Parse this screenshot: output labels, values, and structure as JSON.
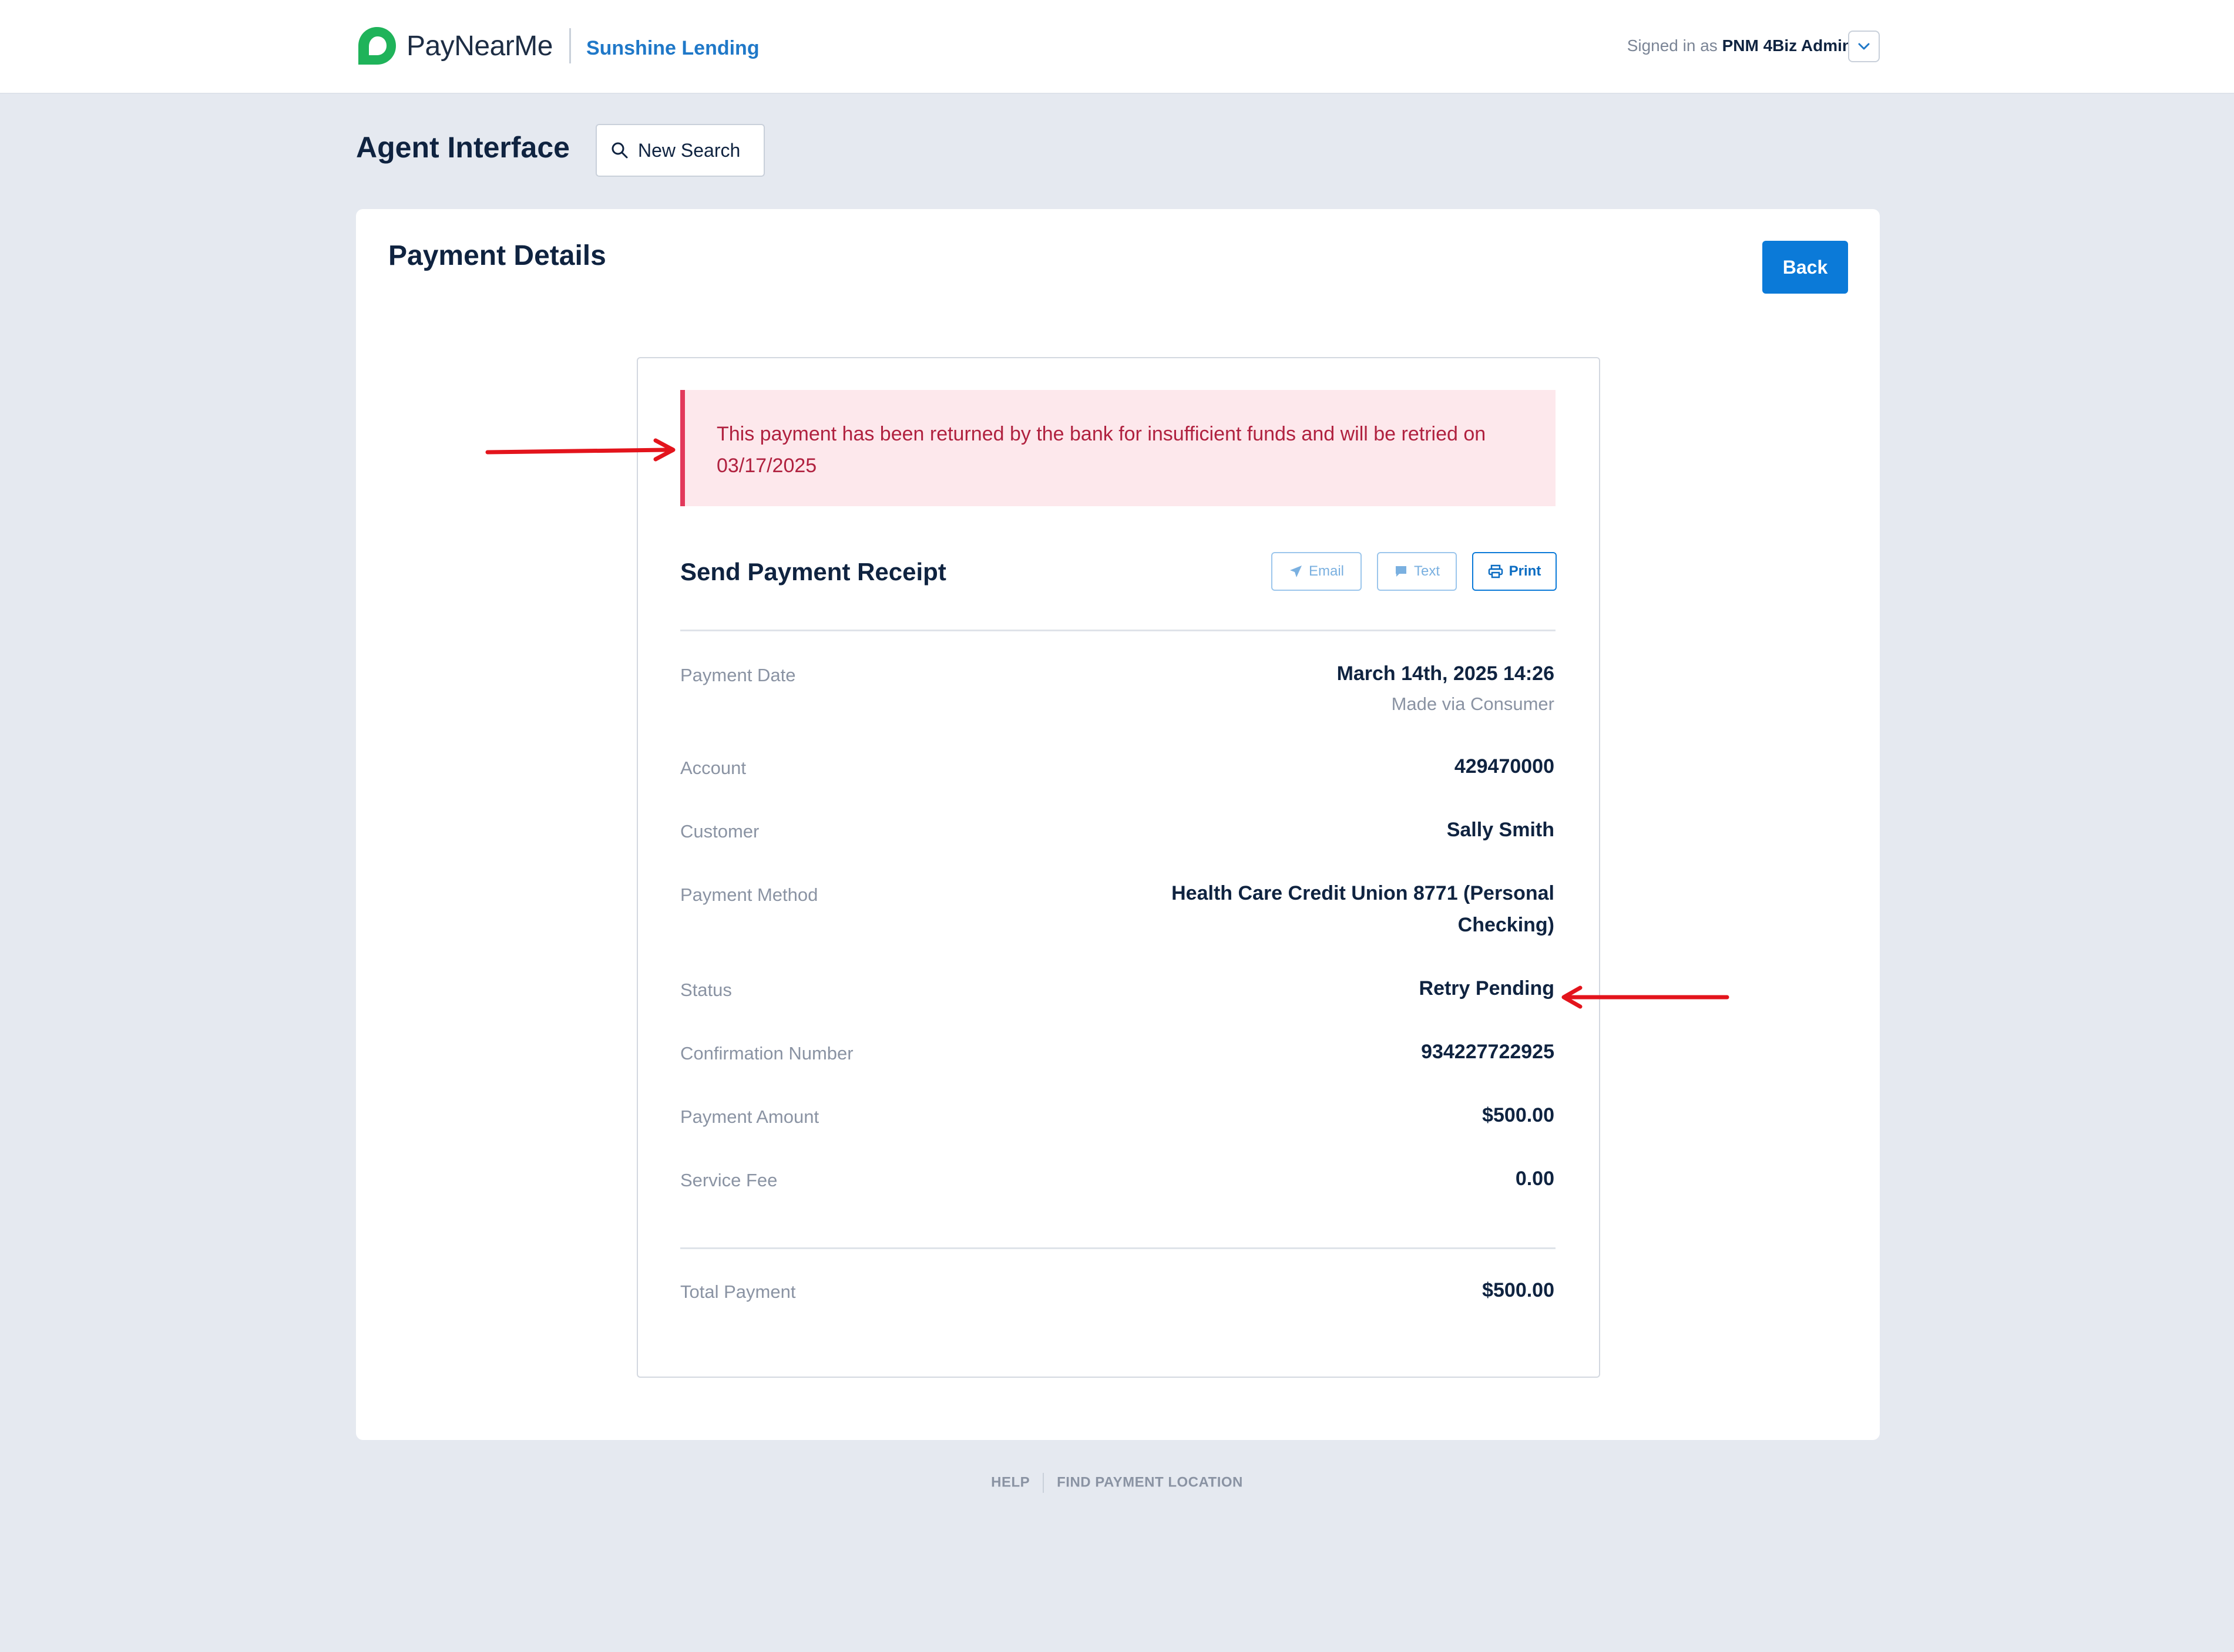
{
  "header": {
    "logo_text": "PayNearMe",
    "business_name": "Sunshine Lending",
    "signed_in_prefix": "Signed in as",
    "signed_in_user": "PNM 4Biz Admin"
  },
  "agent": {
    "title": "Agent Interface",
    "new_search_label": "New Search"
  },
  "page": {
    "title": "Payment Details",
    "back_label": "Back"
  },
  "receipt": {
    "alert_text": "This payment has been returned by the bank for insufficient funds and will be retried on 03/17/2025",
    "title": "Send Payment Receipt",
    "email_label": "Email",
    "text_label": "Text",
    "print_label": "Print",
    "rows": {
      "payment_date": {
        "label": "Payment Date",
        "value": "March 14th, 2025 14:26",
        "sub": "Made via Consumer"
      },
      "account": {
        "label": "Account",
        "value": "429470000"
      },
      "customer": {
        "label": "Customer",
        "value": "Sally Smith"
      },
      "payment_method": {
        "label": "Payment Method",
        "value_line1": "Health Care Credit Union 8771 (Personal",
        "value_line2": "Checking)"
      },
      "status": {
        "label": "Status",
        "value": "Retry Pending"
      },
      "confirmation": {
        "label": "Confirmation Number",
        "value": "934227722925"
      },
      "amount": {
        "label": "Payment Amount",
        "value": "$500.00"
      },
      "fee": {
        "label": "Service Fee",
        "value": "0.00"
      },
      "total": {
        "label": "Total Payment",
        "value": "$500.00"
      }
    }
  },
  "footer": {
    "help": "HELP",
    "find_location": "FIND PAYMENT LOCATION"
  },
  "colors": {
    "brand_green": "#1fb35a",
    "primary_blue": "#0b7ad8",
    "alert_red": "#e2395b",
    "annotation_red": "#e3141c"
  },
  "icons": [
    "paynearme-logo-icon",
    "chevron-down-icon",
    "search-icon",
    "paper-plane-icon",
    "chat-bubble-icon",
    "printer-icon",
    "annotation-arrow-icon"
  ]
}
